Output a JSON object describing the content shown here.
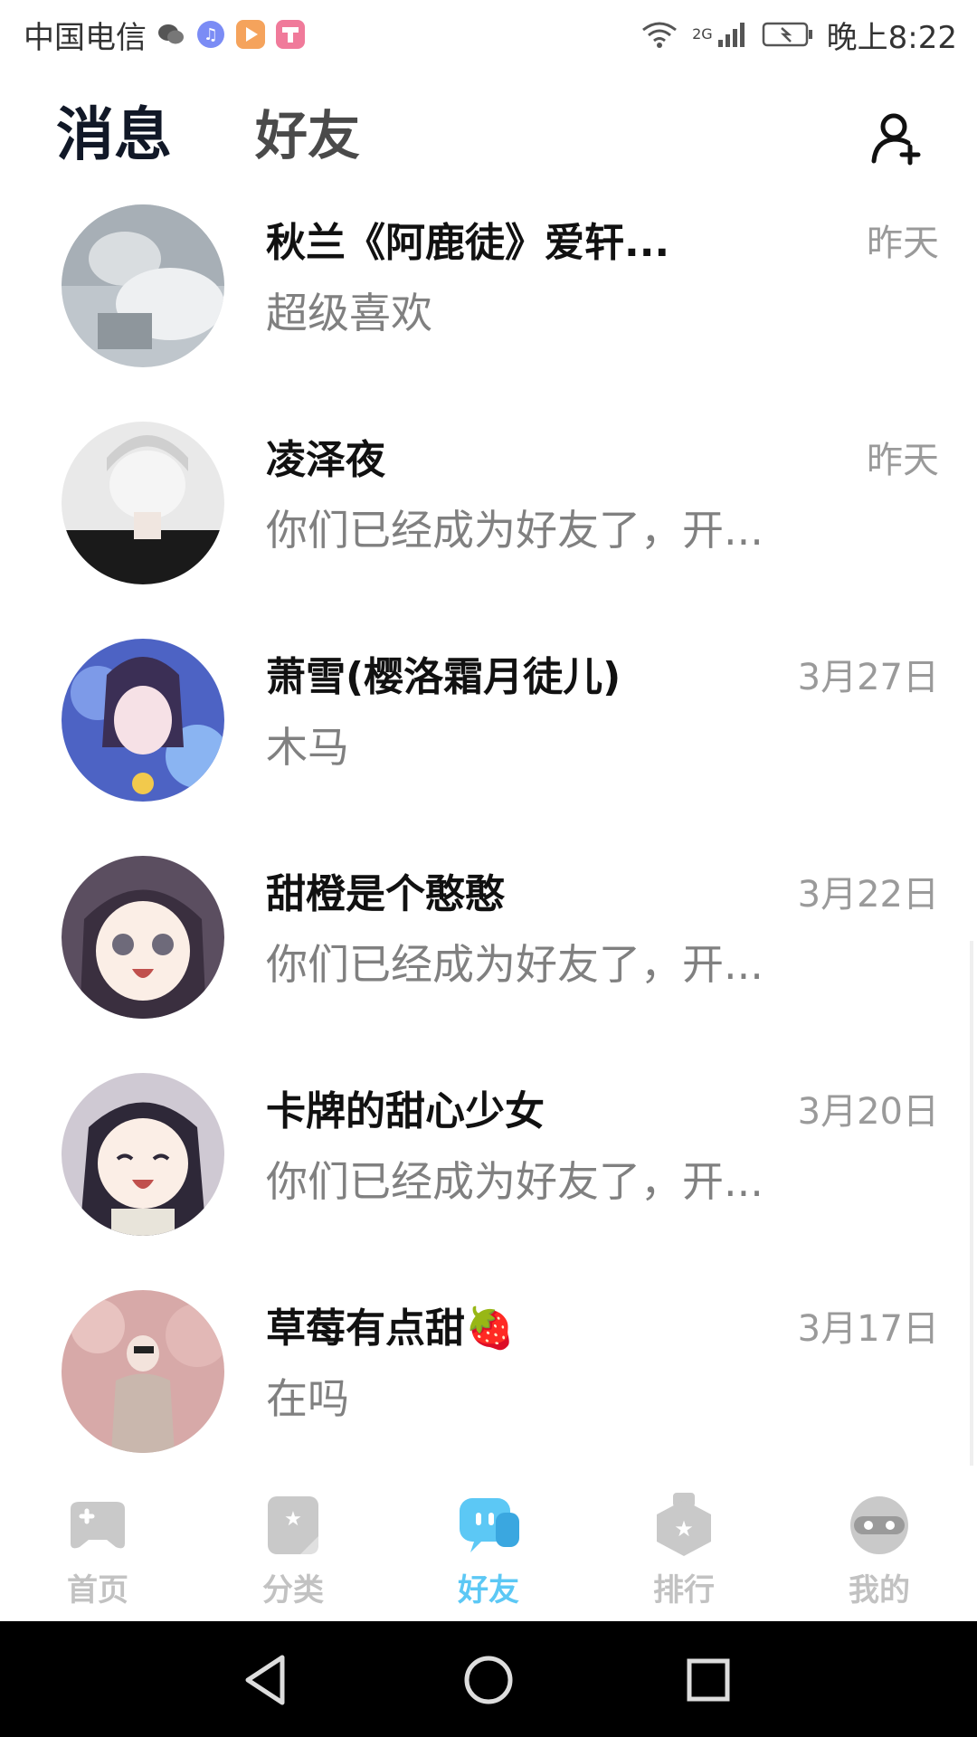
{
  "status_bar": {
    "carrier": "中国电信",
    "network": "2G",
    "time": "晚上8:22"
  },
  "header": {
    "tab_active": "消息",
    "tab_inactive": "好友"
  },
  "conversations": [
    {
      "name": "秋兰《阿鹿徒》爱轩...",
      "message": "超级喜欢",
      "date": "昨天"
    },
    {
      "name": "凌泽夜",
      "message": "你们已经成为好友了，开...",
      "date": "昨天"
    },
    {
      "name": "萧雪(樱洛霜月徒儿)",
      "message": "木马",
      "date": "3月27日"
    },
    {
      "name": "甜橙是个憨憨",
      "message": "你们已经成为好友了，开...",
      "date": "3月22日"
    },
    {
      "name": "卡牌的甜心少女",
      "message": "你们已经成为好友了，开...",
      "date": "3月20日"
    },
    {
      "name": "草莓有点甜🍓",
      "message": "在吗",
      "date": "3月17日"
    }
  ],
  "bottom_nav": [
    {
      "label": "首页",
      "icon": "gamepad-icon"
    },
    {
      "label": "分类",
      "icon": "category-icon"
    },
    {
      "label": "好友",
      "icon": "chat-bubble-icon",
      "active": true
    },
    {
      "label": "排行",
      "icon": "ranking-icon"
    },
    {
      "label": "我的",
      "icon": "profile-icon"
    }
  ],
  "colors": {
    "accent": "#5cc8f5",
    "inactive_nav": "#c2c2c2",
    "title_dark": "#111827"
  }
}
